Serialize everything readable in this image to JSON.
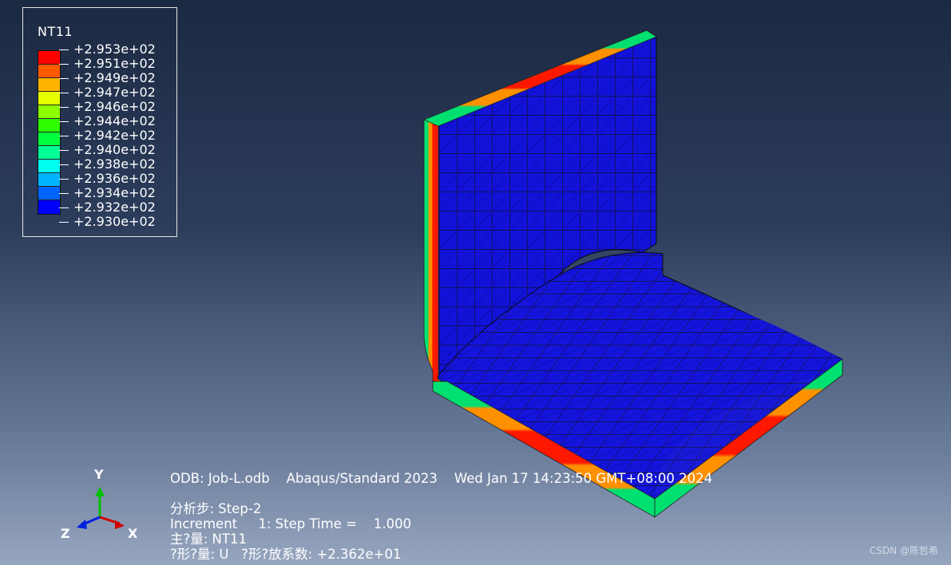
{
  "legend": {
    "title": "NT11",
    "colors": [
      "#ff0000",
      "#ff5a00",
      "#ffb400",
      "#e6ff00",
      "#8cff00",
      "#2dff00",
      "#00ff3c",
      "#00ff96",
      "#00fff0",
      "#00b4ff",
      "#0064ff",
      "#0000ff"
    ],
    "values": [
      "+2.953e+02",
      "+2.951e+02",
      "+2.949e+02",
      "+2.947e+02",
      "+2.946e+02",
      "+2.944e+02",
      "+2.942e+02",
      "+2.940e+02",
      "+2.938e+02",
      "+2.936e+02",
      "+2.934e+02",
      "+2.932e+02",
      "+2.930e+02"
    ]
  },
  "info": {
    "odb_line": "ODB: Job-L.odb    Abaqus/Standard 2023    Wed Jan 17 14:23:50 GMT+08:00 2024",
    "step_line": "分析步: Step-2",
    "increment_line": "Increment     1: Step Time =    1.000",
    "primary_var_line": "主?量: NT11",
    "deformed_var_line": "?形?量: U   ?形?放系数: +2.362e+01"
  },
  "triad": {
    "y": "Y",
    "z": "Z",
    "x": "X"
  },
  "watermark": "CSDN @陈哲希",
  "colors": {
    "mesh_face": "#1010e8",
    "mesh_shadow": "#2a2a30",
    "edge_red": "#ff2000",
    "edge_orange": "#ff8000",
    "edge_green": "#00e060"
  }
}
